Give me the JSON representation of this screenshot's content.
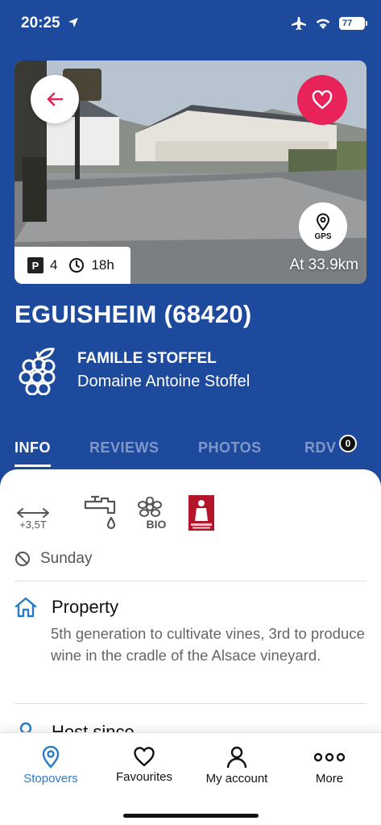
{
  "status": {
    "time": "20:25",
    "battery": "77"
  },
  "hero": {
    "parking_count": "4",
    "duration": "18h",
    "distance": "At 33.9km",
    "gps_label": "GPS"
  },
  "place": {
    "title": "EGUISHEIM (68420)",
    "family": "FAMILLE STOFFEL",
    "domain": "Domaine Antoine Stoffel"
  },
  "tabs": [
    {
      "label": "INFO",
      "active": true
    },
    {
      "label": "REVIEWS"
    },
    {
      "label": "PHOTOS"
    },
    {
      "label": "RDV",
      "badge": "0"
    }
  ],
  "features": {
    "weight_label": "+3,5T",
    "bio_label": "BIO",
    "vigneron_label": "vigneron indépendant"
  },
  "closed_day": "Sunday",
  "property": {
    "label": "Property",
    "description": "5th generation to cultivate vines, 3rd to produce wine in the cradle of the Alsace vineyard."
  },
  "host": {
    "label": "Host since"
  },
  "bottom_nav": {
    "stopovers": "Stopovers",
    "favourites": "Favourites",
    "account": "My account",
    "more": "More"
  },
  "colors": {
    "primary": "#1d4a9c",
    "accent": "#e8235a",
    "active_nav": "#2a7bc6"
  }
}
